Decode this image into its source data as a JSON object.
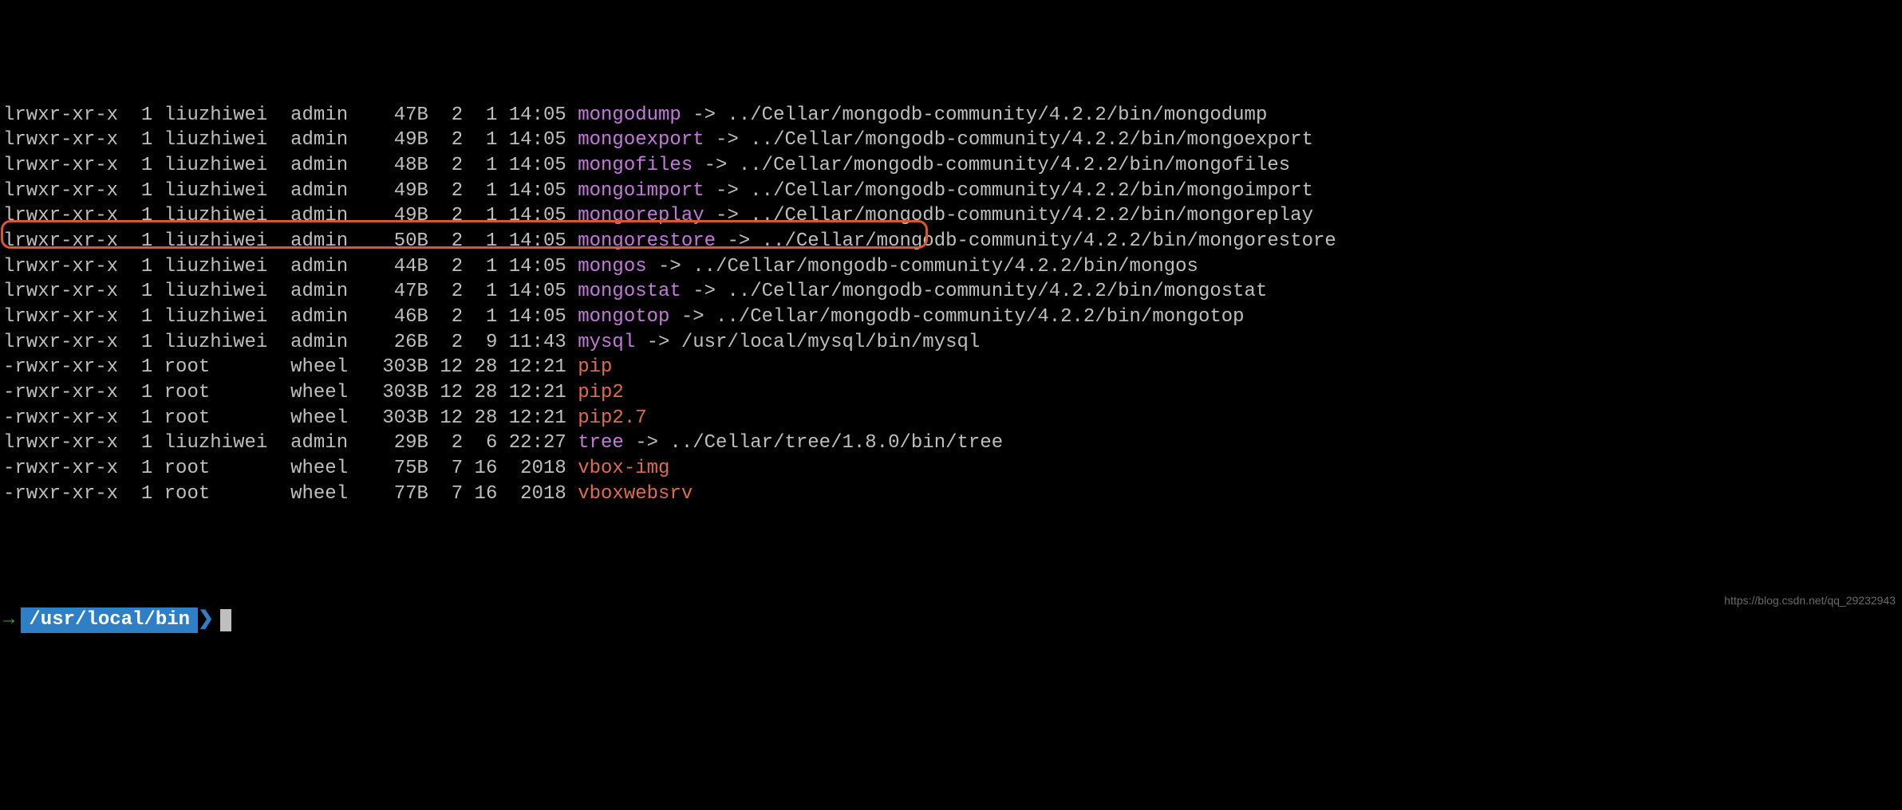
{
  "rows": [
    {
      "perms": "lrwxr-xr-x",
      "links": "1",
      "owner": "liuzhiwei",
      "group": "admin",
      "size": "47B",
      "month": "2",
      "day": "1",
      "time": "14:05",
      "name": "mongodump",
      "type": "symlink",
      "target": "../Cellar/mongodb-community/4.2.2/bin/mongodump"
    },
    {
      "perms": "lrwxr-xr-x",
      "links": "1",
      "owner": "liuzhiwei",
      "group": "admin",
      "size": "49B",
      "month": "2",
      "day": "1",
      "time": "14:05",
      "name": "mongoexport",
      "type": "symlink",
      "target": "../Cellar/mongodb-community/4.2.2/bin/mongoexport"
    },
    {
      "perms": "lrwxr-xr-x",
      "links": "1",
      "owner": "liuzhiwei",
      "group": "admin",
      "size": "48B",
      "month": "2",
      "day": "1",
      "time": "14:05",
      "name": "mongofiles",
      "type": "symlink",
      "target": "../Cellar/mongodb-community/4.2.2/bin/mongofiles"
    },
    {
      "perms": "lrwxr-xr-x",
      "links": "1",
      "owner": "liuzhiwei",
      "group": "admin",
      "size": "49B",
      "month": "2",
      "day": "1",
      "time": "14:05",
      "name": "mongoimport",
      "type": "symlink",
      "target": "../Cellar/mongodb-community/4.2.2/bin/mongoimport"
    },
    {
      "perms": "lrwxr-xr-x",
      "links": "1",
      "owner": "liuzhiwei",
      "group": "admin",
      "size": "49B",
      "month": "2",
      "day": "1",
      "time": "14:05",
      "name": "mongoreplay",
      "type": "symlink",
      "target": "../Cellar/mongodb-community/4.2.2/bin/mongoreplay"
    },
    {
      "perms": "lrwxr-xr-x",
      "links": "1",
      "owner": "liuzhiwei",
      "group": "admin",
      "size": "50B",
      "month": "2",
      "day": "1",
      "time": "14:05",
      "name": "mongorestore",
      "type": "symlink",
      "target": "../Cellar/mongodb-community/4.2.2/bin/mongorestore"
    },
    {
      "perms": "lrwxr-xr-x",
      "links": "1",
      "owner": "liuzhiwei",
      "group": "admin",
      "size": "44B",
      "month": "2",
      "day": "1",
      "time": "14:05",
      "name": "mongos",
      "type": "symlink",
      "target": "../Cellar/mongodb-community/4.2.2/bin/mongos"
    },
    {
      "perms": "lrwxr-xr-x",
      "links": "1",
      "owner": "liuzhiwei",
      "group": "admin",
      "size": "47B",
      "month": "2",
      "day": "1",
      "time": "14:05",
      "name": "mongostat",
      "type": "symlink",
      "target": "../Cellar/mongodb-community/4.2.2/bin/mongostat"
    },
    {
      "perms": "lrwxr-xr-x",
      "links": "1",
      "owner": "liuzhiwei",
      "group": "admin",
      "size": "46B",
      "month": "2",
      "day": "1",
      "time": "14:05",
      "name": "mongotop",
      "type": "symlink",
      "target": "../Cellar/mongodb-community/4.2.2/bin/mongotop"
    },
    {
      "perms": "lrwxr-xr-x",
      "links": "1",
      "owner": "liuzhiwei",
      "group": "admin",
      "size": "26B",
      "month": "2",
      "day": "9",
      "time": "11:43",
      "name": "mysql",
      "type": "symlink",
      "target": "/usr/local/mysql/bin/mysql"
    },
    {
      "perms": "-rwxr-xr-x",
      "links": "1",
      "owner": "root",
      "group": "wheel",
      "size": "303B",
      "month": "12",
      "day": "28",
      "time": "12:21",
      "name": "pip",
      "type": "executable",
      "target": ""
    },
    {
      "perms": "-rwxr-xr-x",
      "links": "1",
      "owner": "root",
      "group": "wheel",
      "size": "303B",
      "month": "12",
      "day": "28",
      "time": "12:21",
      "name": "pip2",
      "type": "executable",
      "target": ""
    },
    {
      "perms": "-rwxr-xr-x",
      "links": "1",
      "owner": "root",
      "group": "wheel",
      "size": "303B",
      "month": "12",
      "day": "28",
      "time": "12:21",
      "name": "pip2.7",
      "type": "executable",
      "target": ""
    },
    {
      "perms": "lrwxr-xr-x",
      "links": "1",
      "owner": "liuzhiwei",
      "group": "admin",
      "size": "29B",
      "month": "2",
      "day": "6",
      "time": "22:27",
      "name": "tree",
      "type": "symlink",
      "target": "../Cellar/tree/1.8.0/bin/tree"
    },
    {
      "perms": "-rwxr-xr-x",
      "links": "1",
      "owner": "root",
      "group": "wheel",
      "size": "75B",
      "month": "7",
      "day": "16",
      "time": "2018",
      "name": "vbox-img",
      "type": "executable",
      "target": ""
    },
    {
      "perms": "-rwxr-xr-x",
      "links": "1",
      "owner": "root",
      "group": "wheel",
      "size": "77B",
      "month": "7",
      "day": "16",
      "time": "2018",
      "name": "vboxwebsrv",
      "type": "executable",
      "target": ""
    }
  ],
  "prompt": {
    "arrow": "→",
    "path": "/usr/local/bin",
    "gt": "❯"
  },
  "watermark": "https://blog.csdn.net/qq_29232943"
}
